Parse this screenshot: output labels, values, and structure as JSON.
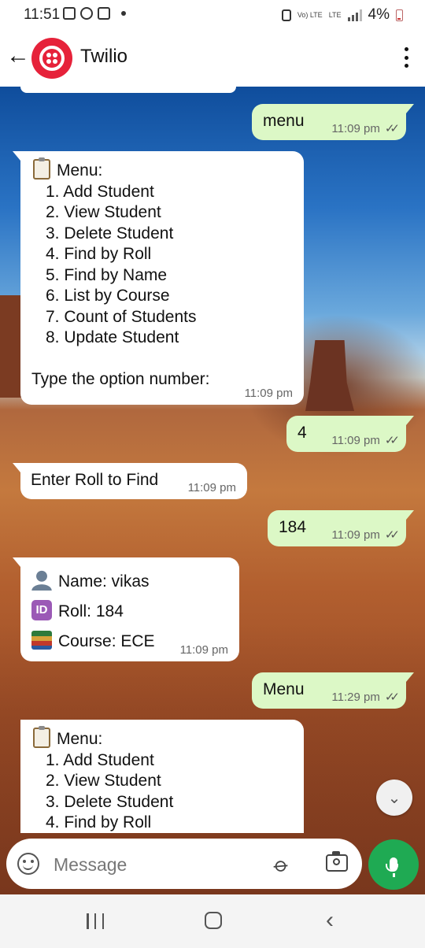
{
  "status_bar": {
    "time": "11:51",
    "network": "Vo) LTE",
    "lte": "LTE",
    "battery": "4%"
  },
  "header": {
    "title": "Twilio"
  },
  "messages": [
    {
      "dir": "out",
      "text": "menu",
      "time": "11:09 pm",
      "ticks": "✓✓"
    },
    {
      "dir": "in",
      "title": "Menu:",
      "items": [
        "1. Add Student",
        "2. View Student",
        "3. Delete Student",
        "4. Find by Roll",
        "5. Find by Name",
        "6. List by Course",
        "7. Count of Students",
        "8. Update Student"
      ],
      "footer": "Type the option number:",
      "time": "11:09 pm"
    },
    {
      "dir": "out",
      "text": "4",
      "time": "11:09 pm",
      "ticks": "✓✓"
    },
    {
      "dir": "in",
      "text": "Enter Roll to Find",
      "time": "11:09 pm"
    },
    {
      "dir": "out",
      "text": "184",
      "time": "11:09 pm",
      "ticks": "✓✓"
    },
    {
      "dir": "in",
      "lines": [
        "Name: vikas",
        "Roll: 184",
        "Course: ECE"
      ],
      "time": "11:09 pm"
    },
    {
      "dir": "out",
      "text": "Menu",
      "time": "11:29 pm",
      "ticks": "✓✓"
    },
    {
      "dir": "in",
      "title": "Menu:",
      "items": [
        "1. Add Student",
        "2. View Student",
        "3. Delete Student",
        "4. Find by Roll"
      ]
    }
  ],
  "composer": {
    "placeholder": "Message"
  },
  "icons": {
    "back": "arrow-left-icon",
    "menu": "more-vert-icon",
    "emoji": "emoji-icon",
    "attach": "paperclip-icon",
    "camera": "camera-icon",
    "mic": "mic-icon",
    "scroll": "chevron-double-down-icon"
  },
  "colors": {
    "accent": "#1faa53",
    "outgoing_bubble": "#dcf8c6",
    "incoming_bubble": "#ffffff",
    "avatar": "#e6223a"
  }
}
